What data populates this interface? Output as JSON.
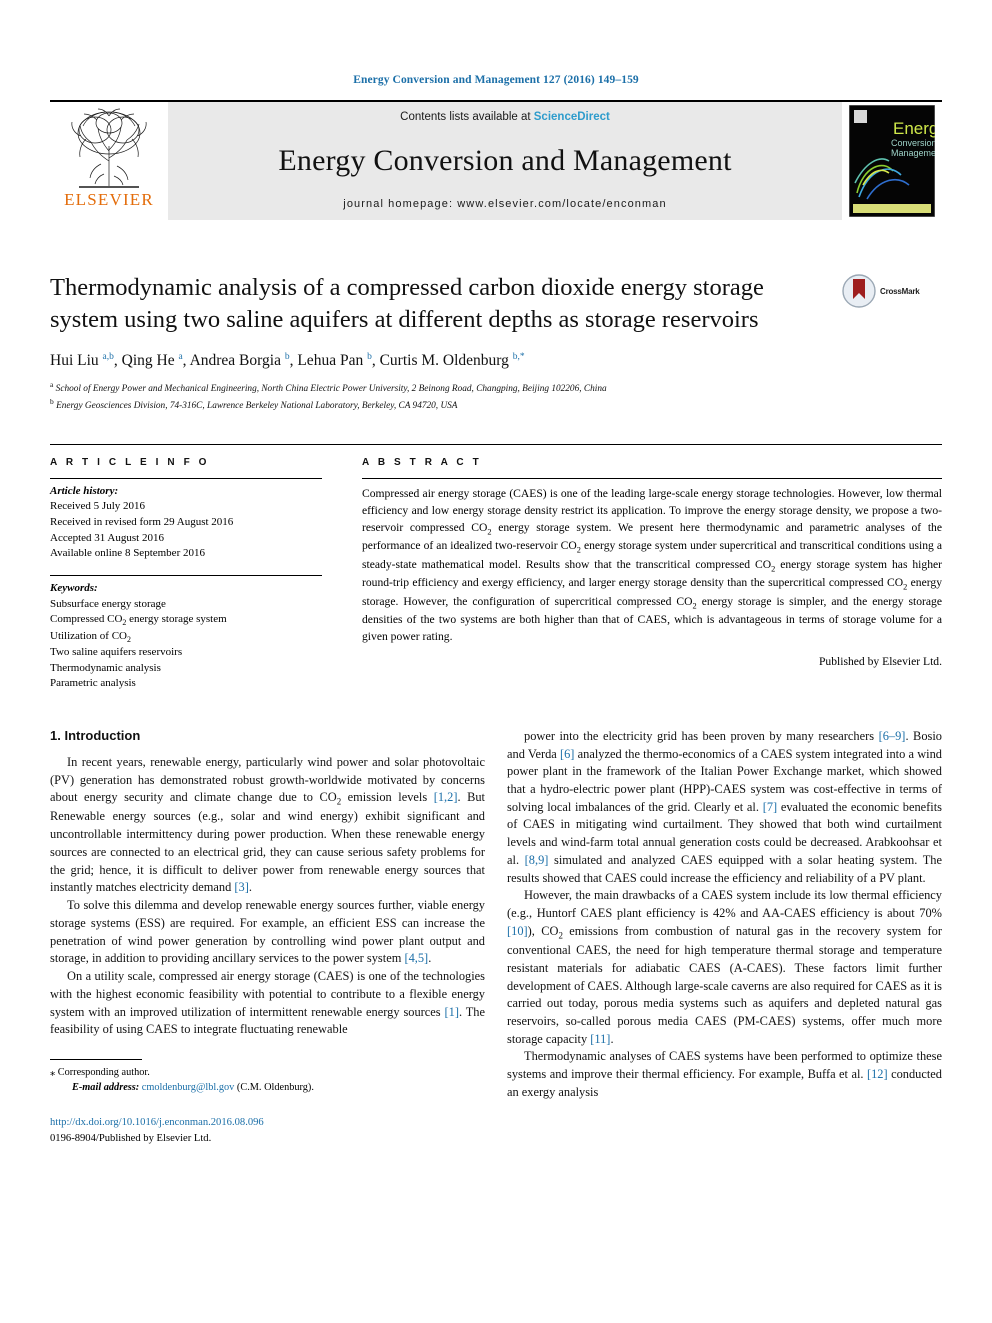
{
  "running_head": "Energy Conversion and Management 127 (2016) 149–159",
  "masthead": {
    "publisher_name": "ELSEVIER",
    "contents_prefix": "Contents lists available at ",
    "contents_link": "ScienceDirect",
    "journal_title": "Energy Conversion and Management",
    "homepage": "journal homepage: www.elsevier.com/locate/enconman",
    "cover_title_line1": "Energy",
    "cover_title_line2": "Conversion",
    "cover_title_line3": "Management"
  },
  "article": {
    "title": "Thermodynamic analysis of a compressed carbon dioxide energy storage system using two saline aquifers at different depths as storage reservoirs",
    "crossmark_label": "CrossMark",
    "authors_html": "Hui Liu <sup>a,b</sup>, Qing He <sup>a</sup>, Andrea Borgia <sup>b</sup>, Lehua Pan <sup>b</sup>, Curtis M. Oldenburg <sup>b,*</sup>",
    "affiliation_a": "School of Energy Power and Mechanical Engineering, North China Electric Power University, 2 Beinong Road, Changping, Beijing 102206, China",
    "affiliation_b": "Energy Geosciences Division, 74-316C, Lawrence Berkeley National Laboratory, Berkeley, CA 94720, USA"
  },
  "article_info": {
    "heading": "A R T I C L E  I N F O",
    "history_heading": "Article history:",
    "history": [
      "Received 5 July 2016",
      "Received in revised form 29 August 2016",
      "Accepted 31 August 2016",
      "Available online 8 September 2016"
    ],
    "keywords_heading": "Keywords:",
    "keywords_html": [
      "Subsurface energy storage",
      "Compressed CO<sub>2</sub> energy storage system",
      "Utilization of CO<sub>2</sub>",
      "Two saline aquifers reservoirs",
      "Thermodynamic analysis",
      "Parametric analysis"
    ]
  },
  "abstract": {
    "heading": "A B S T R A C T",
    "body_html": "Compressed air energy storage (CAES) is one of the leading large-scale energy storage technologies. However, low thermal efficiency and low energy storage density restrict its application. To improve the energy storage density, we propose a two-reservoir compressed CO<sub>2</sub> energy storage system. We present here thermodynamic and parametric analyses of the performance of an idealized two-reservoir CO<sub>2</sub> energy storage system under supercritical and transcritical conditions using a steady-state mathematical model. Results show that the transcritical compressed CO<sub>2</sub> energy storage system has higher round-trip efficiency and exergy efficiency, and larger energy storage density than the supercritical compressed CO<sub>2</sub> energy storage. However, the configuration of supercritical compressed CO<sub>2</sub> energy storage is simpler, and the energy storage densities of the two systems are both higher than that of CAES, which is advantageous in terms of storage volume for a given power rating.",
    "publisher_line": "Published by Elsevier Ltd."
  },
  "introduction": {
    "heading": "1. Introduction",
    "left_paragraphs_html": [
      "In recent years, renewable energy, particularly wind power and solar photovoltaic (PV) generation has demonstrated robust growth-worldwide motivated by concerns about energy security and climate change due to CO<sub>2</sub> emission levels <span class=\"ref\">[1,2]</span>. But Renewable energy sources (e.g., solar and wind energy) exhibit significant and uncontrollable intermittency during power production. When these renewable energy sources are connected to an electrical grid, they can cause serious safety problems for the grid; hence, it is difficult to deliver power from renewable energy sources that instantly matches electricity demand <span class=\"ref\">[3]</span>.",
      "To solve this dilemma and develop renewable energy sources further, viable energy storage systems (ESS) are required. For example, an efficient ESS can increase the penetration of wind power generation by controlling wind power plant output and storage, in addition to providing ancillary services to the power system <span class=\"ref\">[4,5]</span>.",
      "On a utility scale, compressed air energy storage (CAES) is one of the technologies with the highest economic feasibility with potential to contribute to a flexible energy system with an improved utilization of intermittent renewable energy sources <span class=\"ref\">[1]</span>. The feasibility of using CAES to integrate fluctuating renewable"
    ],
    "right_paragraphs_html": [
      "power into the electricity grid has been proven by many researchers <span class=\"ref\">[6–9]</span>. Bosio and Verda <span class=\"ref\">[6]</span> analyzed the thermo-economics of a CAES system integrated into a wind power plant in the framework of the Italian Power Exchange market, which showed that a hydro-electric power plant (HPP)-CAES system was cost-effective in terms of solving local imbalances of the grid. Clearly et al. <span class=\"ref\">[7]</span> evaluated the economic benefits of CAES in mitigating wind curtailment. They showed that both wind curtailment levels and wind-farm total annual generation costs could be decreased. Arabkoohsar et al. <span class=\"ref\">[8,9]</span> simulated and analyzed CAES equipped with a solar heating system. The results showed that CAES could increase the efficiency and reliability of a PV plant.",
      "However, the main drawbacks of a CAES system include its low thermal efficiency (e.g., Huntorf CAES plant efficiency is 42% and AA-CAES efficiency is about 70% <span class=\"ref\">[10]</span>), CO<sub>2</sub> emissions from combustion of natural gas in the recovery system for conventional CAES, the need for high temperature thermal storage and temperature resistant materials for adiabatic CAES (A-CAES). These factors limit further development of CAES. Although large-scale caverns are also required for CAES as it is carried out today, porous media systems such as aquifers and depleted natural gas reservoirs, so-called porous media CAES (PM-CAES) systems, offer much more storage capacity <span class=\"ref\">[11]</span>.",
      "Thermodynamic analyses of CAES systems have been performed to optimize these systems and improve their thermal efficiency. For example, Buffa et al. <span class=\"ref\">[12]</span> conducted an exergy analysis"
    ]
  },
  "footnote": {
    "corresponding_marker": "⁎",
    "corresponding_text": "Corresponding author.",
    "email_label": "E-mail address:",
    "email": "cmoldenburg@lbl.gov",
    "email_owner": "(C.M. Oldenburg)."
  },
  "doi": {
    "url": "http://dx.doi.org/10.1016/j.enconman.2016.08.096",
    "issn_line": "0196-8904/Published by Elsevier Ltd."
  },
  "colors": {
    "link_blue": "#1b6fa8",
    "sciencedirect_blue": "#2e9ccc",
    "elsevier_orange": "#e36c0a",
    "masthead_gray": "#e9e9e9"
  }
}
